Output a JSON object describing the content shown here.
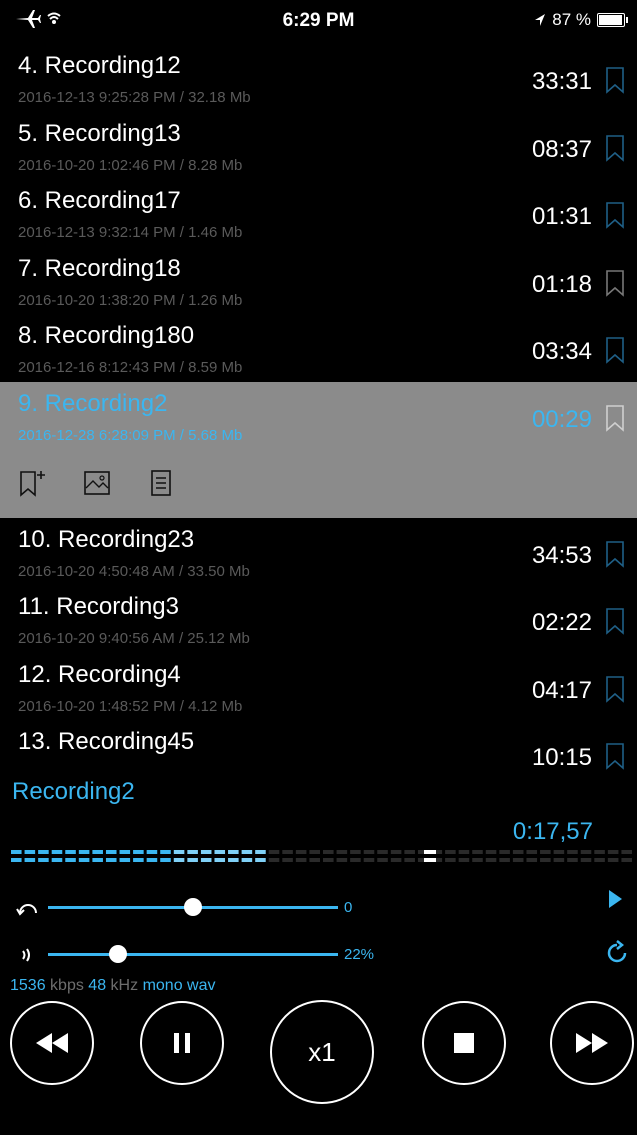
{
  "status_bar": {
    "time": "6:29 PM",
    "battery": "87 %",
    "battery_level": 0.87
  },
  "recordings": [
    {
      "title": "4. Recording12",
      "meta": "2016-12-13 9:25:28 PM / 32.18 Mb",
      "duration": "33:31",
      "bookmark_color": "#1f5f86"
    },
    {
      "title": "5. Recording13",
      "meta": "2016-10-20 1:02:46 PM / 8.28 Mb",
      "duration": "08:37",
      "bookmark_color": "#1f5f86"
    },
    {
      "title": "6. Recording17",
      "meta": "2016-12-13 9:32:14 PM / 1.46 Mb",
      "duration": "01:31",
      "bookmark_color": "#1f5f86"
    },
    {
      "title": "7. Recording18",
      "meta": "2016-10-20 1:38:20 PM / 1.26 Mb",
      "duration": "01:18",
      "bookmark_color": "#777777"
    },
    {
      "title": "8. Recording180",
      "meta": "2016-12-16 8:12:43 PM / 8.59 Mb",
      "duration": "03:34",
      "bookmark_color": "#1f5f86"
    },
    {
      "title": "9. Recording2",
      "meta": "2016-12-28 6:28:09 PM / 5.68 Mb",
      "duration": "00:29",
      "bookmark_color": "#cfcfcf",
      "selected": true
    },
    {
      "title": "10. Recording23",
      "meta": "2016-10-20 4:50:48 AM / 33.50 Mb",
      "duration": "34:53",
      "bookmark_color": "#1f5f86"
    },
    {
      "title": "11. Recording3",
      "meta": "2016-10-20 9:40:56 AM / 25.12 Mb",
      "duration": "02:22",
      "bookmark_color": "#1f5f86"
    },
    {
      "title": "12. Recording4",
      "meta": "2016-10-20 1:48:52 PM / 4.12 Mb",
      "duration": "04:17",
      "bookmark_color": "#1f5f86"
    },
    {
      "title": "13. Recording45",
      "meta": "",
      "duration": "10:15",
      "bookmark_color": "#1f5f86"
    }
  ],
  "selected_actions": [
    "add-bookmark-icon",
    "image-icon",
    "notes-icon"
  ],
  "player": {
    "now_playing": "Recording2",
    "elapsed": "0:17,57",
    "progress": 0.47,
    "pitch_value": "0",
    "pitch_level": 0.5,
    "volume_value": "22%",
    "volume_level": 0.24,
    "bitrate": "1536",
    "bitrate_unit": "kbps",
    "samplerate": "48",
    "samplerate_unit": "kHz",
    "channels": "mono",
    "format": "wav",
    "speed_label": "x1",
    "accent_color": "#3bb6f0"
  }
}
